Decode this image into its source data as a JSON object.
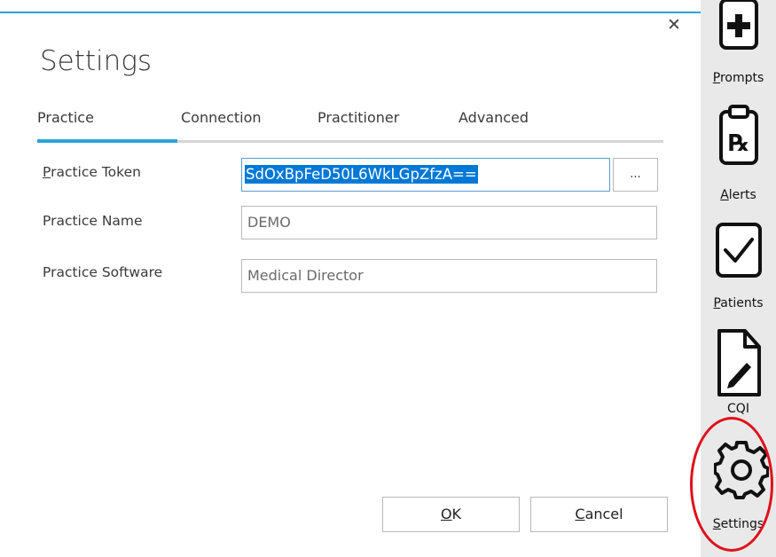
{
  "dialog": {
    "title": "Settings",
    "close_glyph": "✕",
    "tabs": [
      {
        "label": "Practice",
        "active": true
      },
      {
        "label": "Connection",
        "active": false
      },
      {
        "label": "Practitioner",
        "active": false
      },
      {
        "label": "Advanced",
        "active": false
      }
    ],
    "fields": {
      "practice_token": {
        "label_first": "P",
        "label_rest": "ractice Token",
        "value": "SdOxBpFeD50L6WkLGpZfzA=="
      },
      "practice_name": {
        "label": "Practice Name",
        "value": "DEMO"
      },
      "practice_software": {
        "label": "Practice Software",
        "value": "Medical Director"
      }
    },
    "browse_label": "...",
    "ok": {
      "first": "O",
      "rest": "K"
    },
    "cancel": {
      "first": "C",
      "rest": "ancel"
    }
  },
  "sidebar": {
    "items": [
      {
        "first": "P",
        "rest": "rompts",
        "icon": "plus-box-icon"
      },
      {
        "first": "A",
        "rest": "lerts",
        "icon": "prescription-clipboard-icon"
      },
      {
        "first": "P",
        "rest": "atients",
        "icon": "checkbox-icon"
      },
      {
        "label": "CQI",
        "icon": "document-edit-icon"
      },
      {
        "first": "S",
        "rest": "ettings",
        "icon": "gear-icon"
      }
    ]
  },
  "colors": {
    "accent": "#2aa4d8",
    "selection": "#0078d7",
    "highlight_circle": "#e0101a"
  }
}
